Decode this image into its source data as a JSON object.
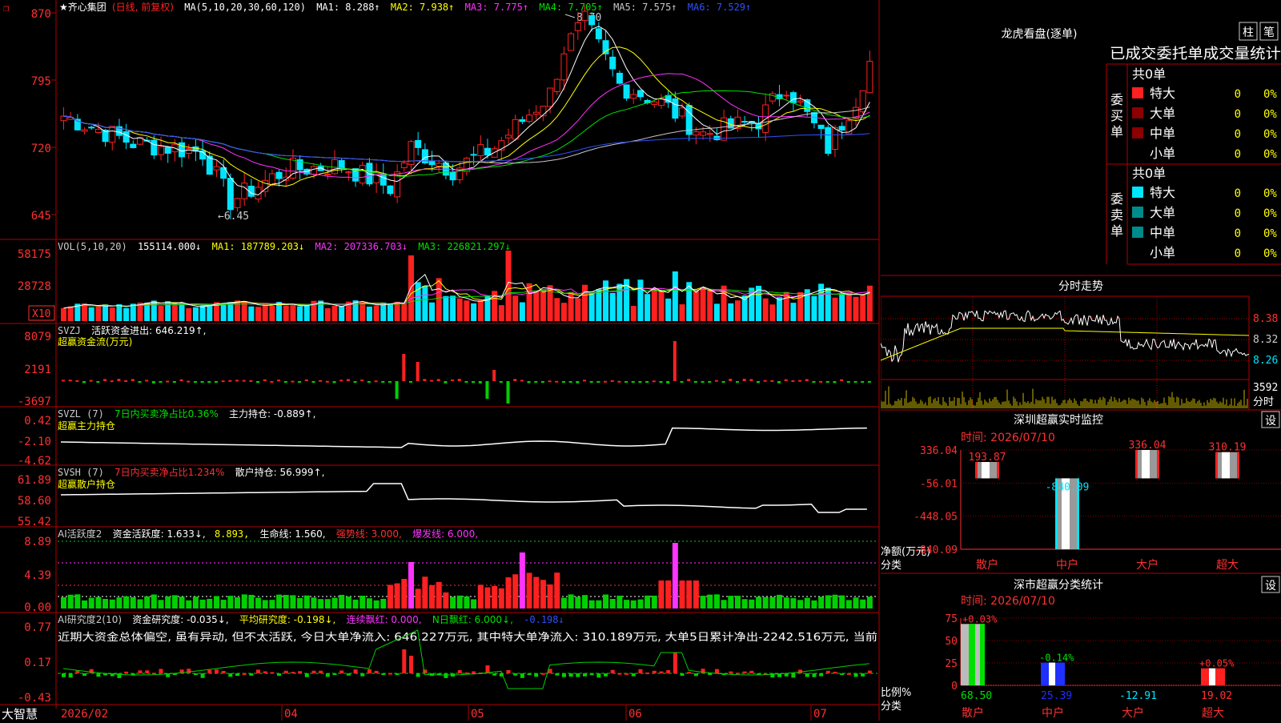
{
  "colors": {
    "up": "#ff2020",
    "down": "#00e5ff",
    "frame": "#b00000",
    "white": "#ffffff",
    "ma2": "#ffff00",
    "ma3": "#ff33ff",
    "ma4": "#00e000",
    "ma5": "#c8c8c8",
    "ma6": "#3050ff",
    "green": "#00d000",
    "yellow": "#ffff00",
    "magenta": "#ff33ff"
  },
  "icons": {
    "bookmark": "bookmark-icon",
    "star": "star-icon"
  },
  "price_panel": {
    "title": "★齐心集团",
    "adj": "(日线, 前复权)",
    "ma_label": "MA(5,10,20,30,60,120)",
    "ma1": "MA1: 8.288↑",
    "ma2": "MA2: 7.938↑",
    "ma3": "MA3: 7.775↑",
    "ma4": "MA4: 7.705↑",
    "ma5": "MA5: 7.575↑",
    "ma6": "MA6: 7.529↑",
    "y_labels": [
      "870",
      "795",
      "720",
      "645"
    ],
    "high_note": "8.70",
    "low_note": "←6.45"
  },
  "vol_panel": {
    "title": "VOL(5,10,20)",
    "v": "155114.000↓",
    "ma1": "MA1: 187789.203↓",
    "ma2": "MA2: 207336.703↓",
    "ma3": "MA3: 226821.297↓",
    "y_labels": [
      "58175",
      "28728"
    ],
    "unit": "X10"
  },
  "svzj_panel": {
    "title": "SVZJ",
    "l1": "活跃资金进出: 646.219↑,",
    "l2": "超赢资金流(万元)",
    "y_labels": [
      "8079",
      "2191",
      "-3697"
    ]
  },
  "svzl_panel": {
    "title": "SVZL (7)",
    "l1": "7日内买卖净占比0.36%",
    "l2": "主力持仓: -0.889↑,",
    "l3": "超赢主力持仓",
    "y_labels": [
      "0.42",
      "-2.10",
      "-4.62"
    ]
  },
  "svsh_panel": {
    "title": "SVSH (7)",
    "l1": "7日内买卖净占比1.234%",
    "l2": "散户持仓: 56.999↑,",
    "l3": "超赢散户持仓",
    "y_labels": [
      "61.89",
      "58.60",
      "55.42"
    ]
  },
  "ai2_panel": {
    "title": "AI活跃度2",
    "l1": "资金活跃度: 1.633↓,",
    "l2": "8.893,",
    "l3": "生命线: 1.560,",
    "l4": "强势线: 3.000,",
    "l5": "爆发线: 6.000,",
    "y_labels": [
      "8.89",
      "4.39",
      "0.00"
    ]
  },
  "ai_research": {
    "title": "AI研究度2(10)",
    "l1": "资金研究度: -0.035↓,",
    "l2": "平均研究度: -0.198↓,",
    "l3": "连续飘红: 0.000,",
    "l4": "N日飘红: 6.000↓,",
    "l5": "-0.198↓",
    "text": "近期大资金总体偏空, 虽有异动, 但不太活跃, 今日大单净流入: 646.227万元, 其中特大单净流入: 310.189万元, 大单5日累计净出-2242.516万元, 当前",
    "y_labels": [
      "0.77",
      "0.17",
      "-0.43"
    ]
  },
  "xaxis": {
    "brand": "大智慧",
    "labels": [
      "2026/02",
      "04",
      "05",
      "06",
      "07"
    ]
  },
  "dragon": {
    "title": "龙虎看盘(逐单)",
    "btn1": "柱",
    "btn2": "笔",
    "subtitle": "已成交委托单成交量统计",
    "buy": {
      "side": "委买单",
      "total": "共0单",
      "rows": [
        {
          "name": "特大",
          "n": "0",
          "p": "0%"
        },
        {
          "name": "大单",
          "n": "0",
          "p": "0%"
        },
        {
          "name": "中单",
          "n": "0",
          "p": "0%"
        },
        {
          "name": "小单",
          "n": "0",
          "p": "0%"
        }
      ]
    },
    "sell": {
      "side": "委卖单",
      "total": "共0单",
      "rows": [
        {
          "name": "特大",
          "n": "0",
          "p": "0%"
        },
        {
          "name": "大单",
          "n": "0",
          "p": "0%"
        },
        {
          "name": "中单",
          "n": "0",
          "p": "0%"
        },
        {
          "name": "小单",
          "n": "0",
          "p": "0%"
        }
      ]
    }
  },
  "intraday": {
    "title": "分时走势",
    "y_labels": [
      "8.38",
      "8.32",
      "8.26"
    ],
    "vol_label": "3592",
    "vol_unit": "分时"
  },
  "sz_monitor": {
    "title": "深圳超赢实时监控",
    "btn": "设",
    "time": "时间: 2026/07/10",
    "ylabel": "净额(万元)",
    "xlabel": "分类",
    "y_labels": [
      "336.04",
      "-56.01",
      "-448.05",
      "-840.09"
    ],
    "bars": [
      {
        "cat": "散户",
        "value": 193.87,
        "label": "193.87"
      },
      {
        "cat": "中户",
        "value": -840.09,
        "label": "-840.09"
      },
      {
        "cat": "大户",
        "value": 336.04,
        "label": "336.04"
      },
      {
        "cat": "超大",
        "value": 310.19,
        "label": "310.19"
      }
    ]
  },
  "sz_stats": {
    "title": "深市超赢分类统计",
    "btn": "设",
    "time": "时间: 2026/07/10",
    "ylabel": "比例%",
    "xlabel": "分类",
    "y_labels": [
      "75",
      "50",
      "25",
      "0"
    ],
    "bars": [
      {
        "cat": "散户",
        "value": 68.5,
        "label": "68.50",
        "top": "+0.03%"
      },
      {
        "cat": "中户",
        "value": 25.39,
        "label": "25.39",
        "top": "-0.14%"
      },
      {
        "cat": "大户",
        "value": -12.91,
        "label": "-12.91",
        "top": ""
      },
      {
        "cat": "超大",
        "value": 19.02,
        "label": "19.02",
        "top": "+0.05%"
      }
    ]
  }
}
